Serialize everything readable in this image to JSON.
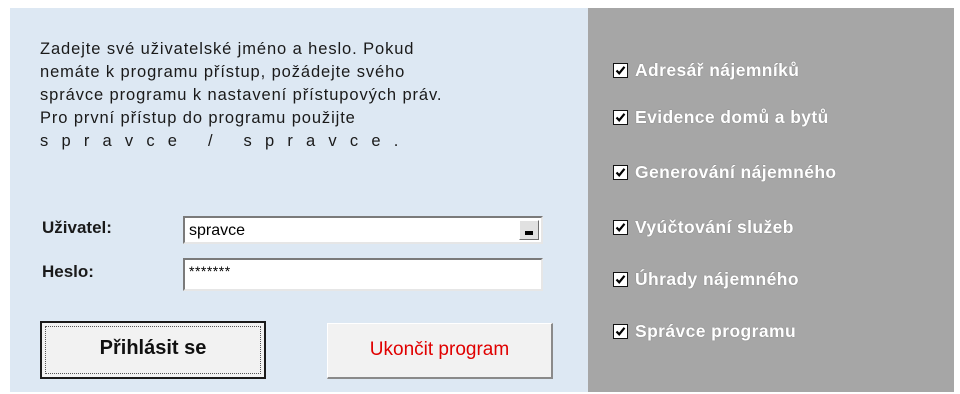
{
  "intro": {
    "line1": "Zadejte své uživatelské jméno a heslo. Pokud",
    "line2": "nemáte k programu přístup, požádejte svého",
    "line3": "správce programu k nastavení přístupových práv.",
    "line4": "Pro první přístup do programu použijte",
    "line5": "spravce / spravce."
  },
  "login": {
    "user_label": "Uživatel:",
    "user_value": "spravce",
    "password_label": "Heslo:",
    "password_value": "*******",
    "login_button": "Přihlásit se",
    "quit_button": "Ukončit program"
  },
  "modules": [
    {
      "label": "Adresář nájemníků",
      "checked": true
    },
    {
      "label": "Evidence domů a bytů",
      "checked": true
    },
    {
      "label": "Generování nájemného",
      "checked": true
    },
    {
      "label": "Vyúčtování služeb",
      "checked": true
    },
    {
      "label": "Úhrady nájemného",
      "checked": true
    },
    {
      "label": "Správce programu",
      "checked": true
    }
  ],
  "colors": {
    "left_panel": "#dde8f3",
    "right_panel": "#a6a6a6",
    "quit_text": "#e00000"
  }
}
